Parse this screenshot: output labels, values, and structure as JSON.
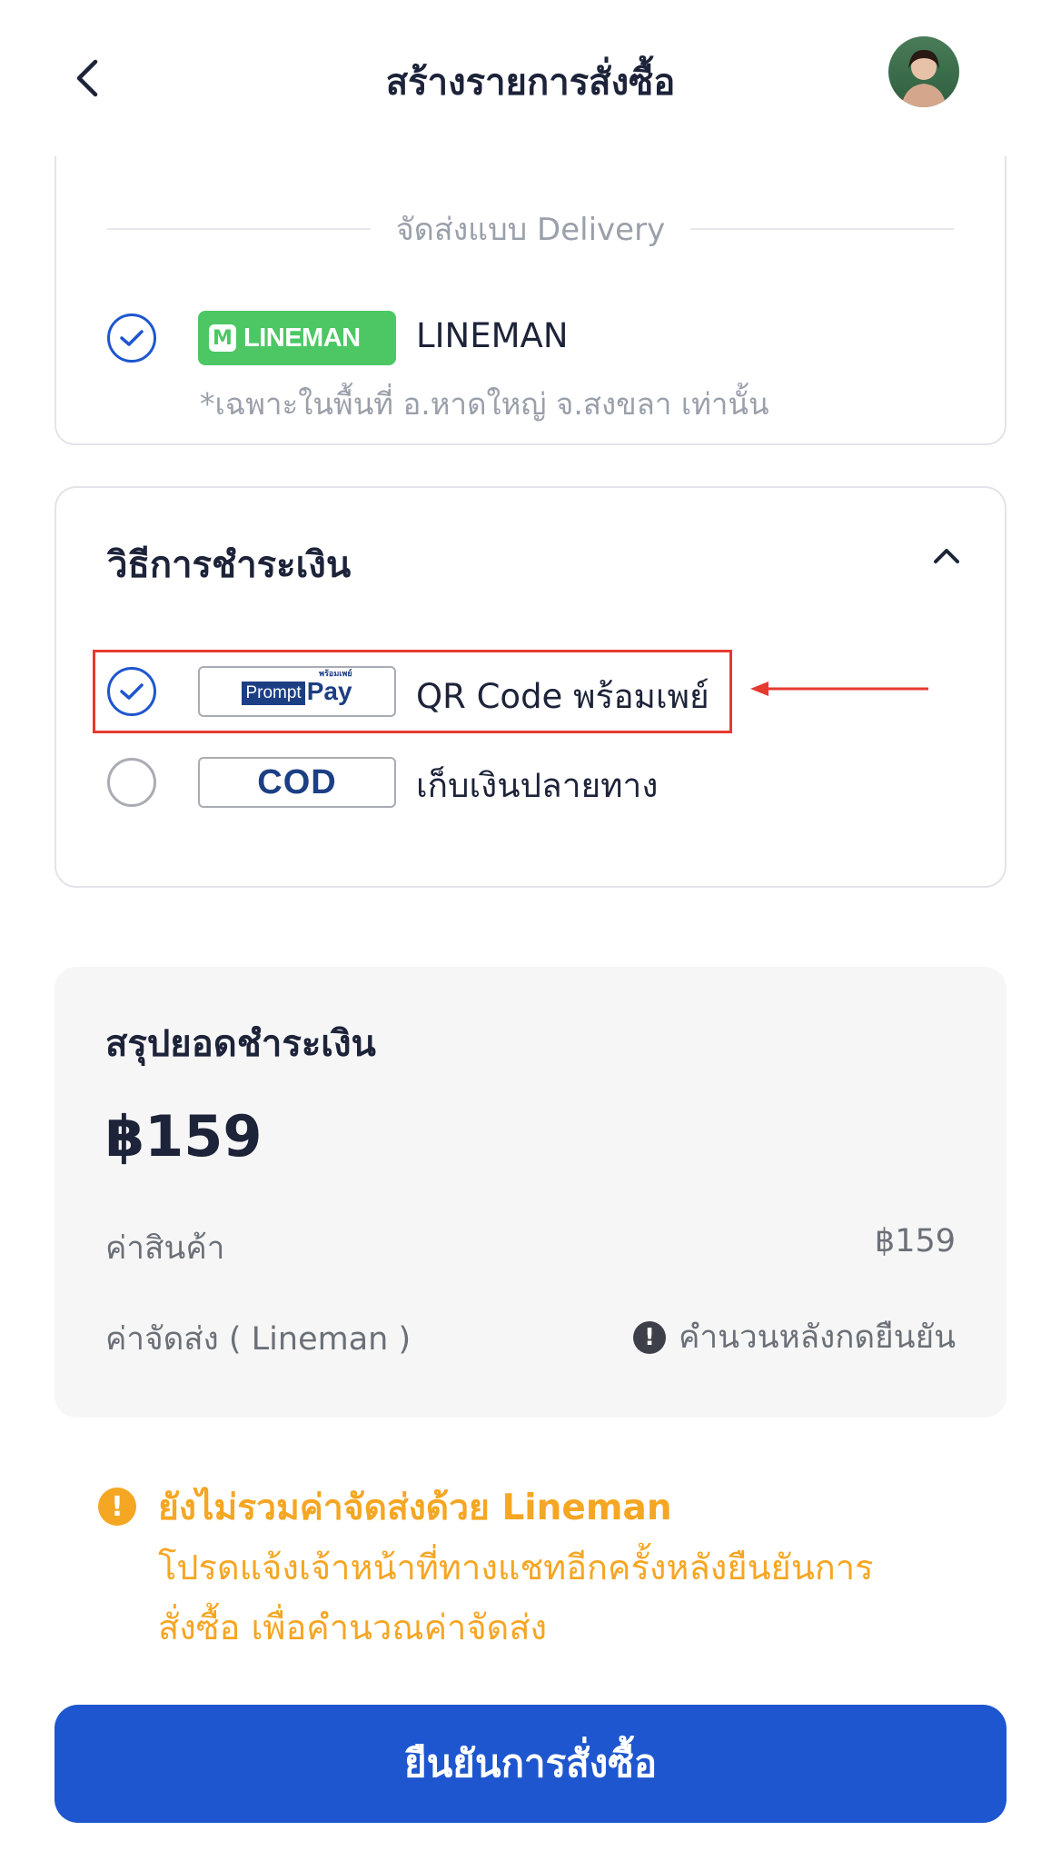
{
  "header": {
    "title": "สร้างรายการสั่งซื้อ",
    "back_icon": "chevron-left-icon",
    "avatar": "user-avatar"
  },
  "delivery": {
    "divider_label": "จัดส่งแบบ Delivery",
    "option": {
      "selected": true,
      "logo_text": "LINEMAN",
      "logo_letter": "M",
      "label": "LINEMAN",
      "note": "*เฉพาะในพื้นที่ อ.หาดใหญ่ จ.สงขลา เท่านั้น"
    }
  },
  "payment": {
    "title": "วิธีการชำระเงิน",
    "expanded": true,
    "options": [
      {
        "selected": true,
        "logo_prompt": "Prompt",
        "logo_pay": "Pay",
        "logo_thai": "พร้อมเพย์",
        "label": "QR Code พร้อมเพย์",
        "highlighted": true
      },
      {
        "selected": false,
        "logo_text": "COD",
        "label": "เก็บเงินปลายทาง"
      }
    ],
    "annotation_color": "#e53a2f"
  },
  "summary": {
    "title": "สรุปยอดชำระเงิน",
    "total": "฿159",
    "rows": [
      {
        "label": "ค่าสินค้า",
        "value": "฿159"
      },
      {
        "label": "ค่าจัดส่ง ( Lineman )",
        "value": "คำนวนหลังกดยืนยัน",
        "icon": "info-icon",
        "icon_glyph": "!"
      }
    ]
  },
  "warning": {
    "icon": "warning-icon",
    "icon_glyph": "!",
    "title": "ยังไม่รวมค่าจัดส่งด้วย Lineman",
    "body_line1": "โปรดแจ้งเจ้าหน้าที่ทางแชทอีกครั้งหลังยืนยันการ",
    "body_line2": "สั่งซื้อ เพื่อคำนวณค่าจัดส่ง",
    "color": "#f5a623"
  },
  "confirm_button": {
    "label": "ยืนยันการสั่งซื้อ",
    "color": "#1e56cf"
  }
}
